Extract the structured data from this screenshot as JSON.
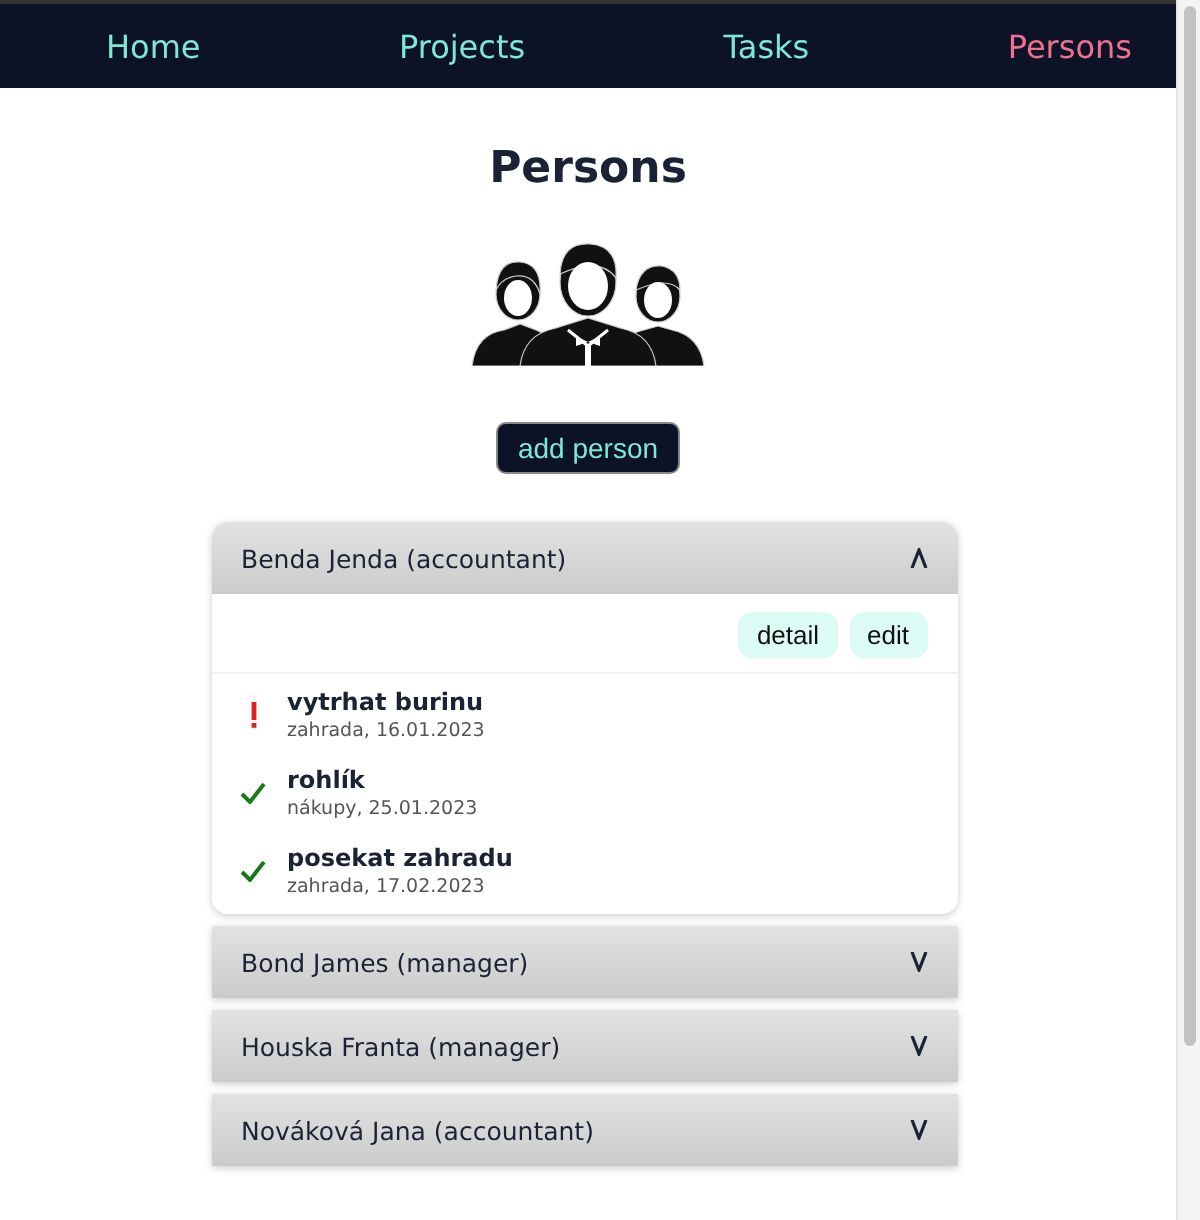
{
  "nav": [
    {
      "label": "Home",
      "selected": false
    },
    {
      "label": "Projects",
      "selected": false
    },
    {
      "label": "Tasks",
      "selected": false
    },
    {
      "label": "Persons",
      "selected": true
    }
  ],
  "heading": "Persons",
  "add_button": "add person",
  "persons": [
    {
      "name": "Benda Jenda (accountant)",
      "expanded": true,
      "actions": [
        "detail",
        "edit"
      ],
      "tasks": [
        {
          "title": "vytrhat burinu",
          "meta": "zahrada, 16.01.2023",
          "done": false
        },
        {
          "title": "rohlík",
          "meta": "nákupy, 25.01.2023",
          "done": true
        },
        {
          "title": "posekat zahradu",
          "meta": "zahrada, 17.02.2023",
          "done": true
        }
      ]
    },
    {
      "name": "Bond James (manager)",
      "expanded": false
    },
    {
      "name": "Houska Franta (manager)",
      "expanded": false
    },
    {
      "name": "Nováková Jana (accountant)",
      "expanded": false
    }
  ]
}
